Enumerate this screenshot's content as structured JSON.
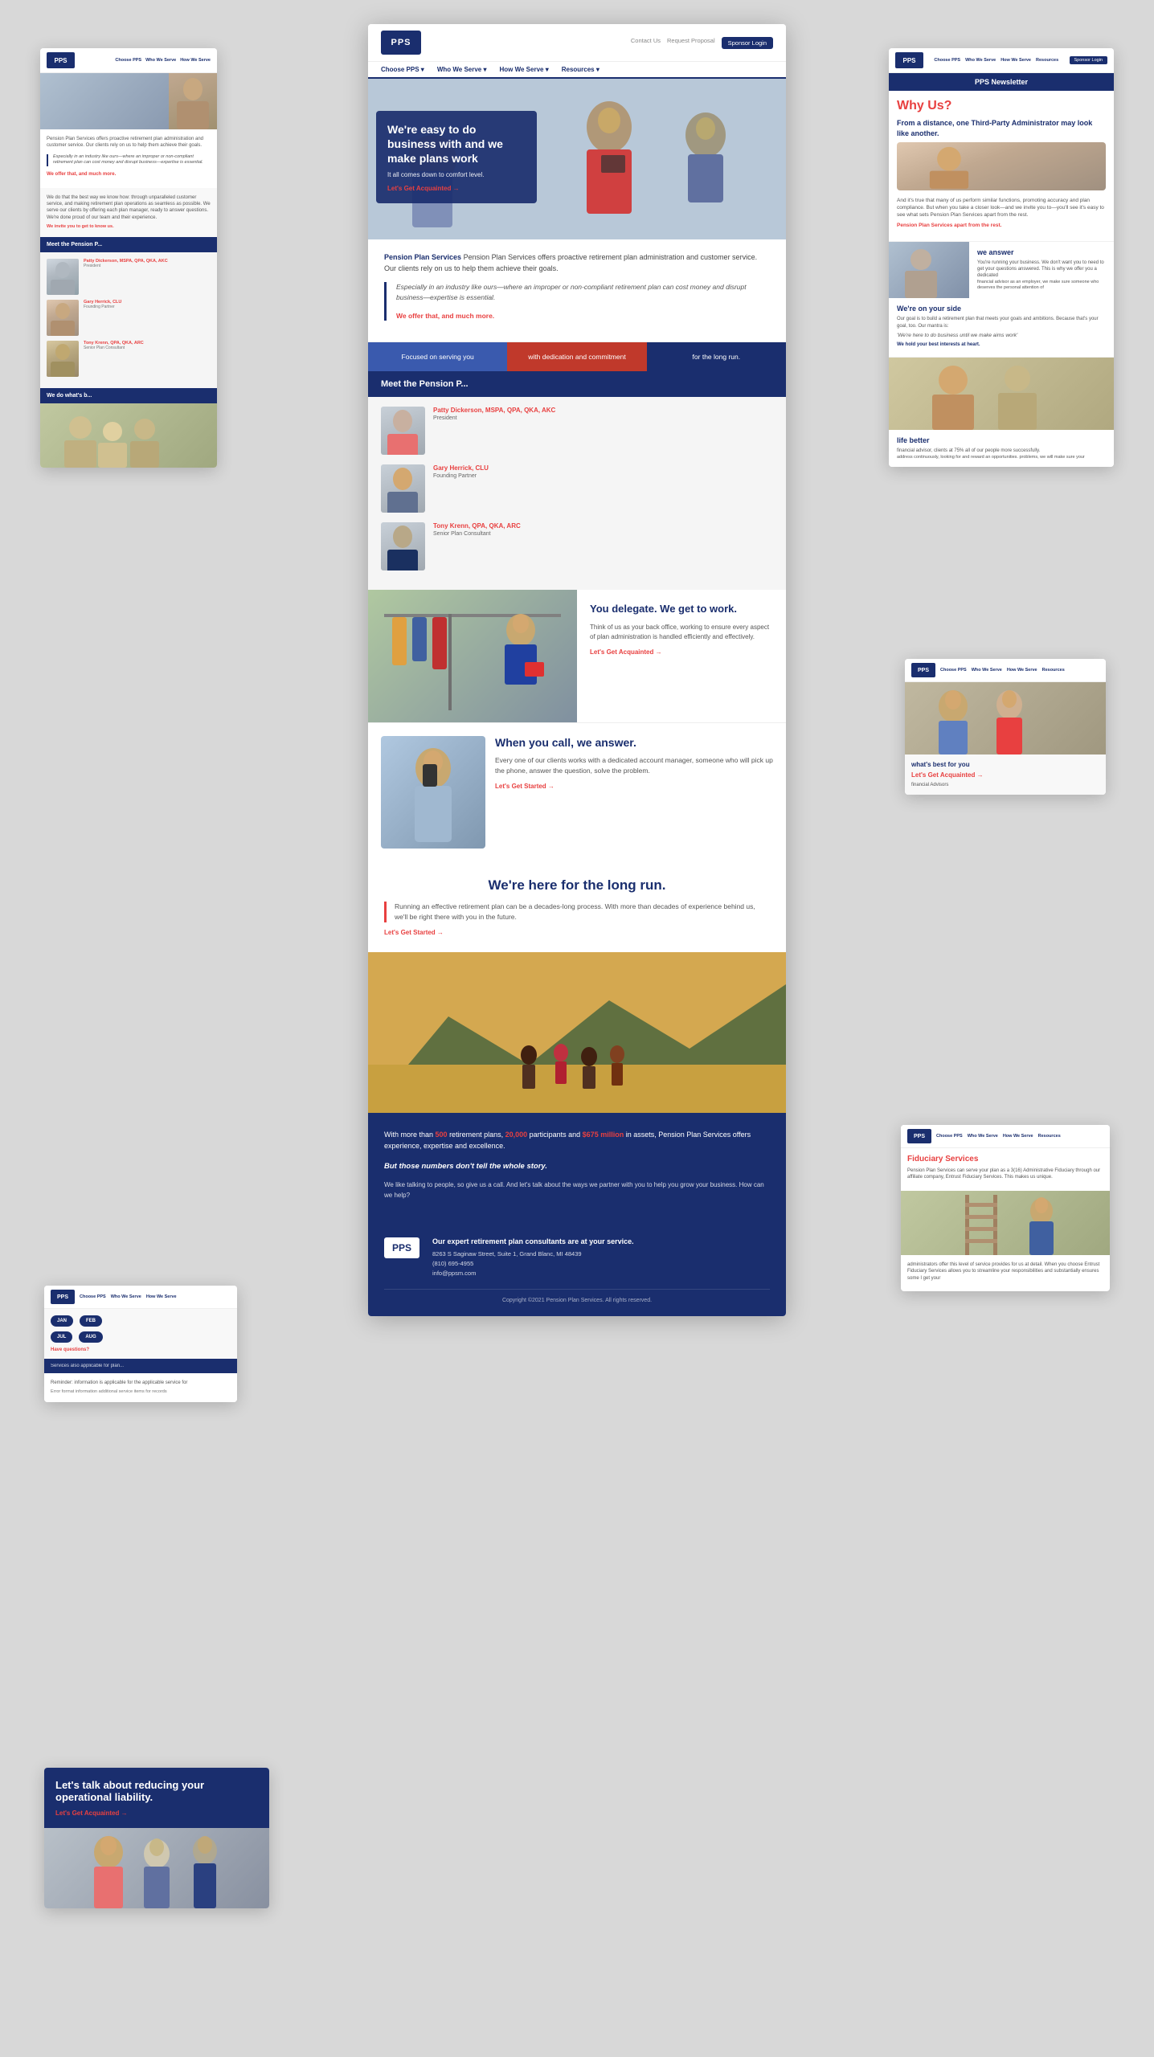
{
  "brand": {
    "logo_text": "PPS",
    "logo_full": "Pension Plan Services",
    "tagline": "Focused on serving you"
  },
  "nav": {
    "contact": "Contact Us",
    "proposal": "Request Proposal",
    "sponsor_login": "Sponsor Login",
    "items": [
      "Choose PPS ▾",
      "Who We Serve ▾",
      "How We Serve ▾",
      "Resources ▾"
    ]
  },
  "hero": {
    "heading": "We're easy to do business with and we make plans work",
    "subtext": "It all comes down to comfort level.",
    "cta": "Let's Get Acquainted →"
  },
  "intro": {
    "body": "Pension Plan Services offers proactive retirement plan administration and customer service. Our clients rely on us to help them achieve their goals.",
    "quote": "Especially in an industry like ours—where an improper or non-compliant retirement plan can cost money and disrupt business—expertise is essential.",
    "highlight": "We offer that, and much more."
  },
  "tagline_bar": {
    "segment1": "Focused on serving you",
    "segment2": "with dedication and commitment",
    "segment3": "for the long run."
  },
  "meet_team": {
    "heading": "Meet the Pension P...",
    "members": [
      {
        "name": "Patty Dickerson, MSPA, QPA, QKA, AKC",
        "title": "President"
      },
      {
        "name": "Gary Herrick, CLU",
        "title": "Founding Partner"
      },
      {
        "name": "Tony Krenn, QPA, QKA, ARC",
        "title": "Senior Plan Consultant"
      }
    ]
  },
  "delegate_section": {
    "heading": "You delegate. We get to work.",
    "body": "Think of us as your back office, working to ensure every aspect of plan administration is handled efficiently and effectively.",
    "cta": "Let's Get Acquainted →"
  },
  "call_section": {
    "heading": "When you call, we answer.",
    "body": "Every one of our clients works with a dedicated account manager, someone who will pick up the phone, answer the question, solve the problem.",
    "cta": "Let's Get Started →"
  },
  "long_run_section": {
    "heading": "We're here for the long run.",
    "body": "Running an effective retirement plan can be a decades-long process. With more than decades of experience behind us, we'll be right there with you in the future.",
    "cta": "Let's Get Started →"
  },
  "stats_section": {
    "body": "With more than 500 retirement plans, 20,000 participants and $675 million in assets, Pension Plan Services offers experience, expertise and excellence.",
    "stats": {
      "plans": "500",
      "participants": "20,000",
      "assets": "$675 million"
    },
    "quote": "But those numbers don't tell the whole story.",
    "sub": "We like talking to people, so give us a call. And let's talk about the ways we partner with you to help you grow your business. How can we help?"
  },
  "footer": {
    "tagline": "Our expert retirement plan consultants are at your service.",
    "address": "8263 S Saginaw Street, Suite 1, Grand Blanc, MI 48439",
    "phone": "(810) 695-4955",
    "email": "info@ppsm.com",
    "copyright": "Copyright ©2021 Pension Plan Services. All rights reserved."
  },
  "why_us": {
    "heading": "Why Us?",
    "subheading": "From a distance, one Third-Party Administrator may look like another.",
    "body": "And it's true that many of us perform similar functions, promoting accuracy and plan compliance. But when you take a closer look—and we invite you to—you'll see it's easy to see what sets Pension Plan Services apart from the rest.",
    "link_text": "Pension Plan Services apart from the rest."
  },
  "we_answer": {
    "heading": "we answer",
    "body": "You're running your business. We don't want you to need to get your questions answered. This is why we offer you a dedicated",
    "sub": "financial advisor as an employer, we make sure someone who deserves the personal attention of"
  },
  "on_your_side": {
    "heading": "We're on your side",
    "body": "Our goal is to build a retirement plan that meets your goals and ambitions. Because that's your goal, too. Our mantra is:",
    "mantra": "'We're here to do business until we make aims work'",
    "sub": "We hold your best interests at heart."
  },
  "life_better": {
    "heading": "life better",
    "body": "financial advisor, clients at 75% all of our people more successfully.",
    "sub": "address continuously, looking for and reward an opportunities. problems, we will make sure your"
  },
  "newsletter": {
    "heading": "PPS Newsletter"
  },
  "fiduciary": {
    "heading": "Fiduciary Services",
    "body": "Pension Plan Services can serve your plan as a 3(16) Administrative Fiduciary through our affiliate company, Entrust Fiduciary Services. This makes us unique.",
    "sub_body": "administrators offer this level of service provides for us at detail. When you choose Entrust Fiduciary Services allows you to streamline your responsibilities and substantially ensures some I get your"
  },
  "reduce_liability": {
    "heading": "Let's talk about reducing your operational liability.",
    "cta": "Let's Get Acquainted →"
  },
  "what_best": {
    "heading": "what's best for you",
    "cta": "Let's Get Acquainted →",
    "sub": "financial Advisors"
  },
  "we_do_best": {
    "heading": "We do what's b..."
  }
}
